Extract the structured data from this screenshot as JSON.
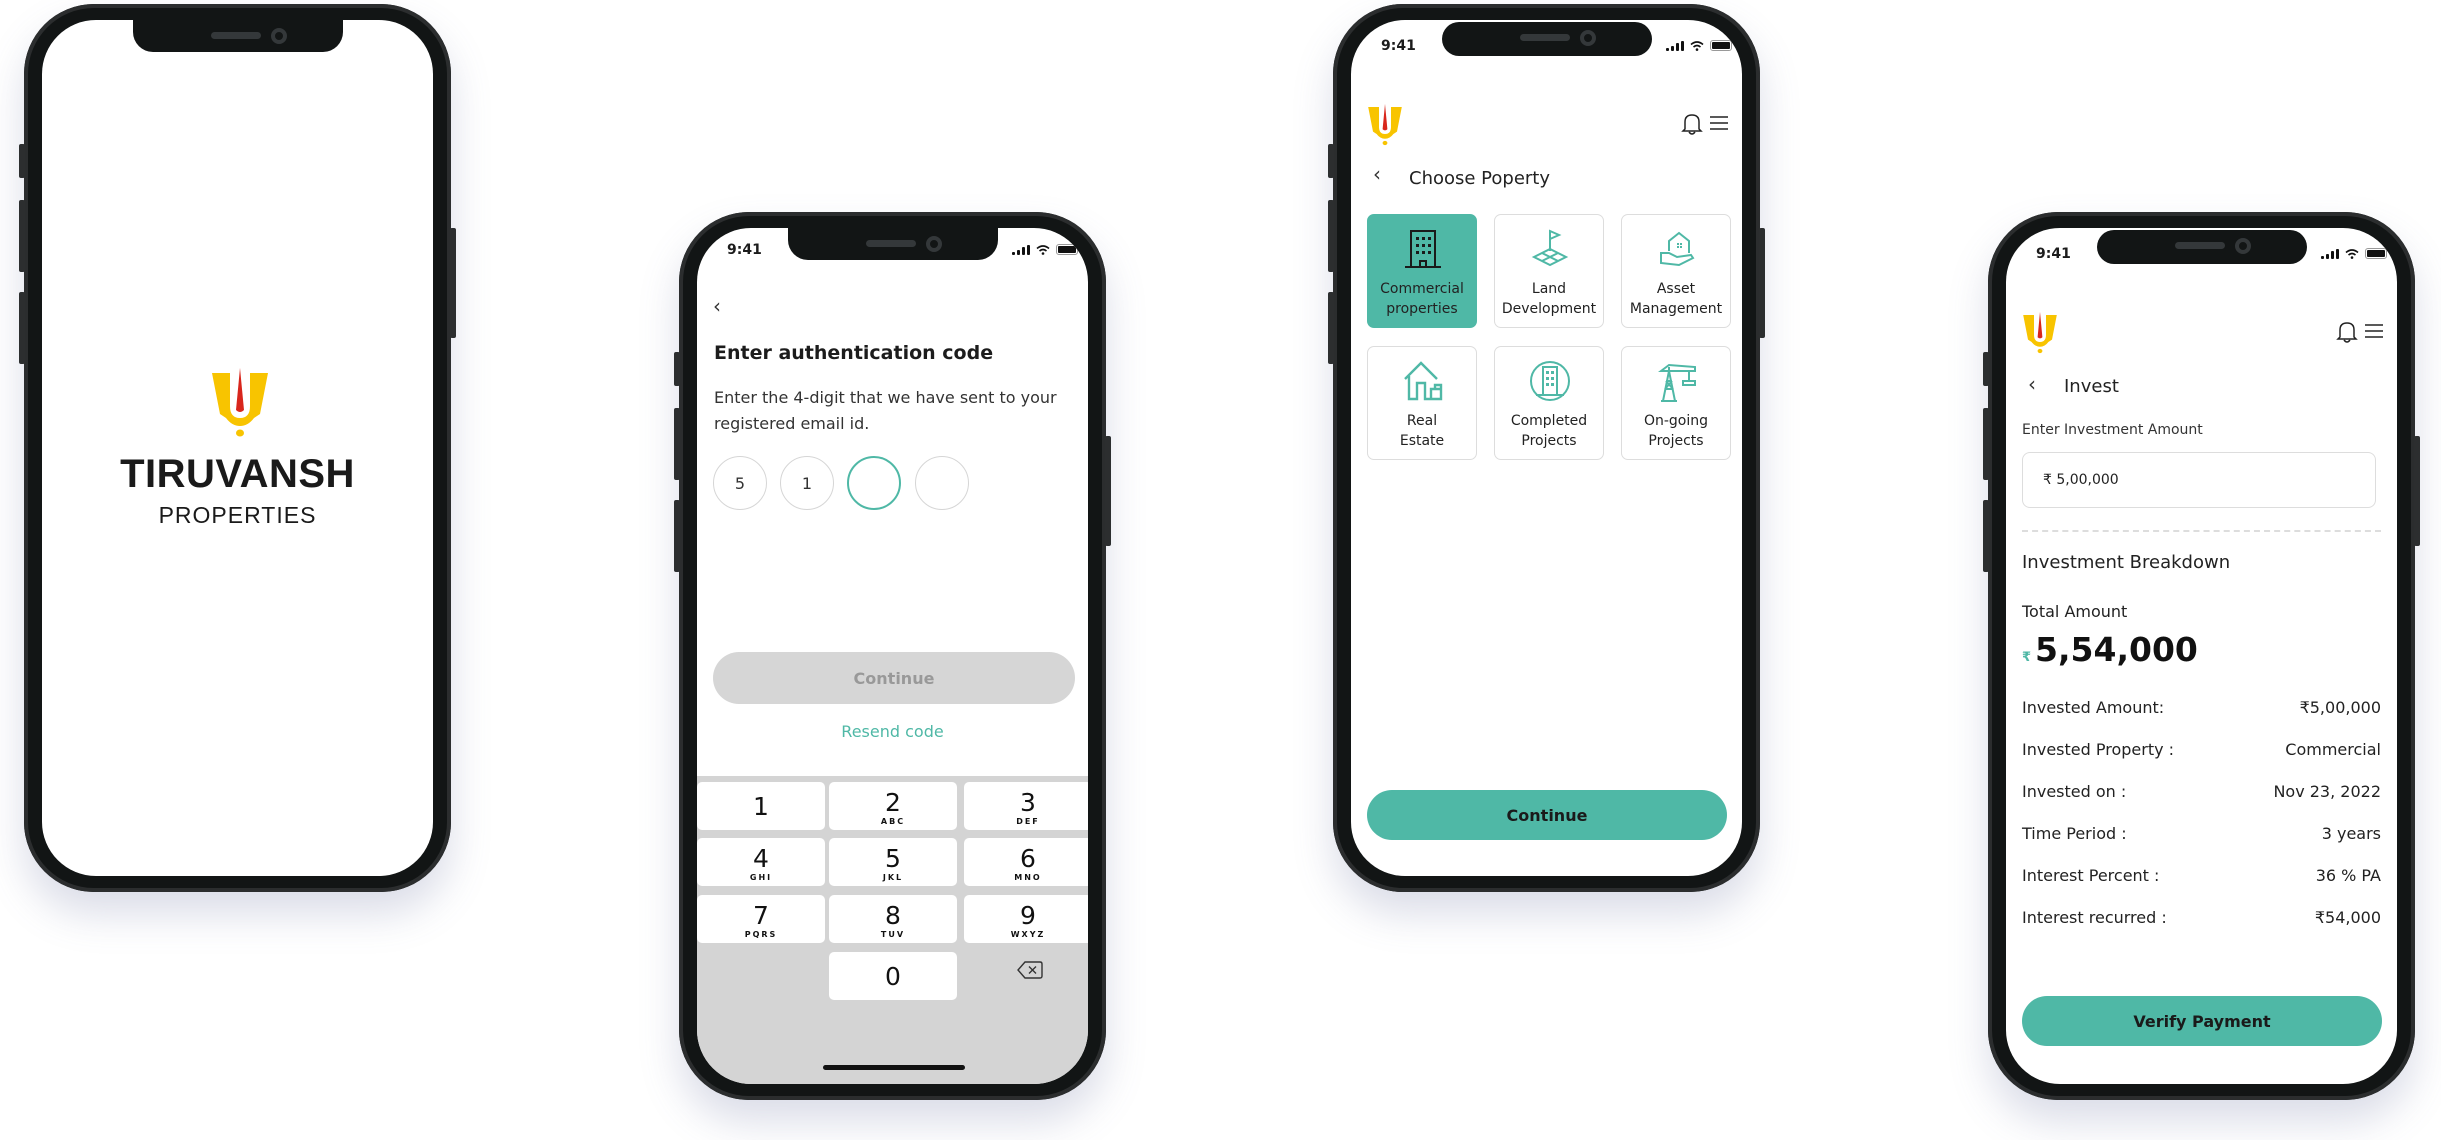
{
  "brand": {
    "name": "TIRUVANSH",
    "subtitle": "PROPERTIES",
    "colors": {
      "primary": "#4fb8a6",
      "logo_yellow": "#f8c400",
      "logo_red": "#d8261c"
    }
  },
  "status_bar": {
    "time": "9:41"
  },
  "auth": {
    "title": "Enter authentication code",
    "description": "Enter the 4-digit that we have sent to your registered email id.",
    "otp_digits": [
      "5",
      "1",
      "",
      ""
    ],
    "continue_label": "Continue",
    "resend_label": "Resend code",
    "keypad": [
      {
        "n": "1",
        "l": ""
      },
      {
        "n": "2",
        "l": "ABC"
      },
      {
        "n": "3",
        "l": "DEF"
      },
      {
        "n": "4",
        "l": "GHI"
      },
      {
        "n": "5",
        "l": "JKL"
      },
      {
        "n": "6",
        "l": "MNO"
      },
      {
        "n": "7",
        "l": "PQRS"
      },
      {
        "n": "8",
        "l": "TUV"
      },
      {
        "n": "9",
        "l": "WXYZ"
      },
      {
        "n": "0",
        "l": ""
      }
    ]
  },
  "choose_property": {
    "title": "Choose Poperty",
    "tiles": [
      {
        "label_1": "Commercial",
        "label_2": "properties",
        "icon": "office-building-icon",
        "selected": true
      },
      {
        "label_1": "Land",
        "label_2": "Development",
        "icon": "land-flag-icon",
        "selected": false
      },
      {
        "label_1": "Asset",
        "label_2": "Management",
        "icon": "hand-house-icon",
        "selected": false
      },
      {
        "label_1": "Real",
        "label_2": "Estate",
        "icon": "house-icon",
        "selected": false
      },
      {
        "label_1": "Completed",
        "label_2": "Projects",
        "icon": "building-circle-icon",
        "selected": false
      },
      {
        "label_1": "On-going",
        "label_2": "Projects",
        "icon": "crane-icon",
        "selected": false
      }
    ],
    "continue_label": "Continue"
  },
  "invest": {
    "title": "Invest",
    "amount_label": "Enter Investment Amount",
    "amount_value": "₹ 5,00,000",
    "breakdown_title": "Investment Breakdown",
    "total_label": "Total Amount",
    "total_currency": "₹",
    "total_value": "5,54,000",
    "rows": [
      {
        "label": "Invested Amount:",
        "value": "₹5,00,000"
      },
      {
        "label": "Invested Property :",
        "value": "Commercial"
      },
      {
        "label": "Invested on :",
        "value": "Nov 23, 2022"
      },
      {
        "label": "Time Period :",
        "value": "3 years"
      },
      {
        "label": "Interest Percent :",
        "value": "36 % PA"
      },
      {
        "label": "Interest recurred :",
        "value": "₹54,000"
      }
    ],
    "verify_label": "Verify Payment"
  }
}
